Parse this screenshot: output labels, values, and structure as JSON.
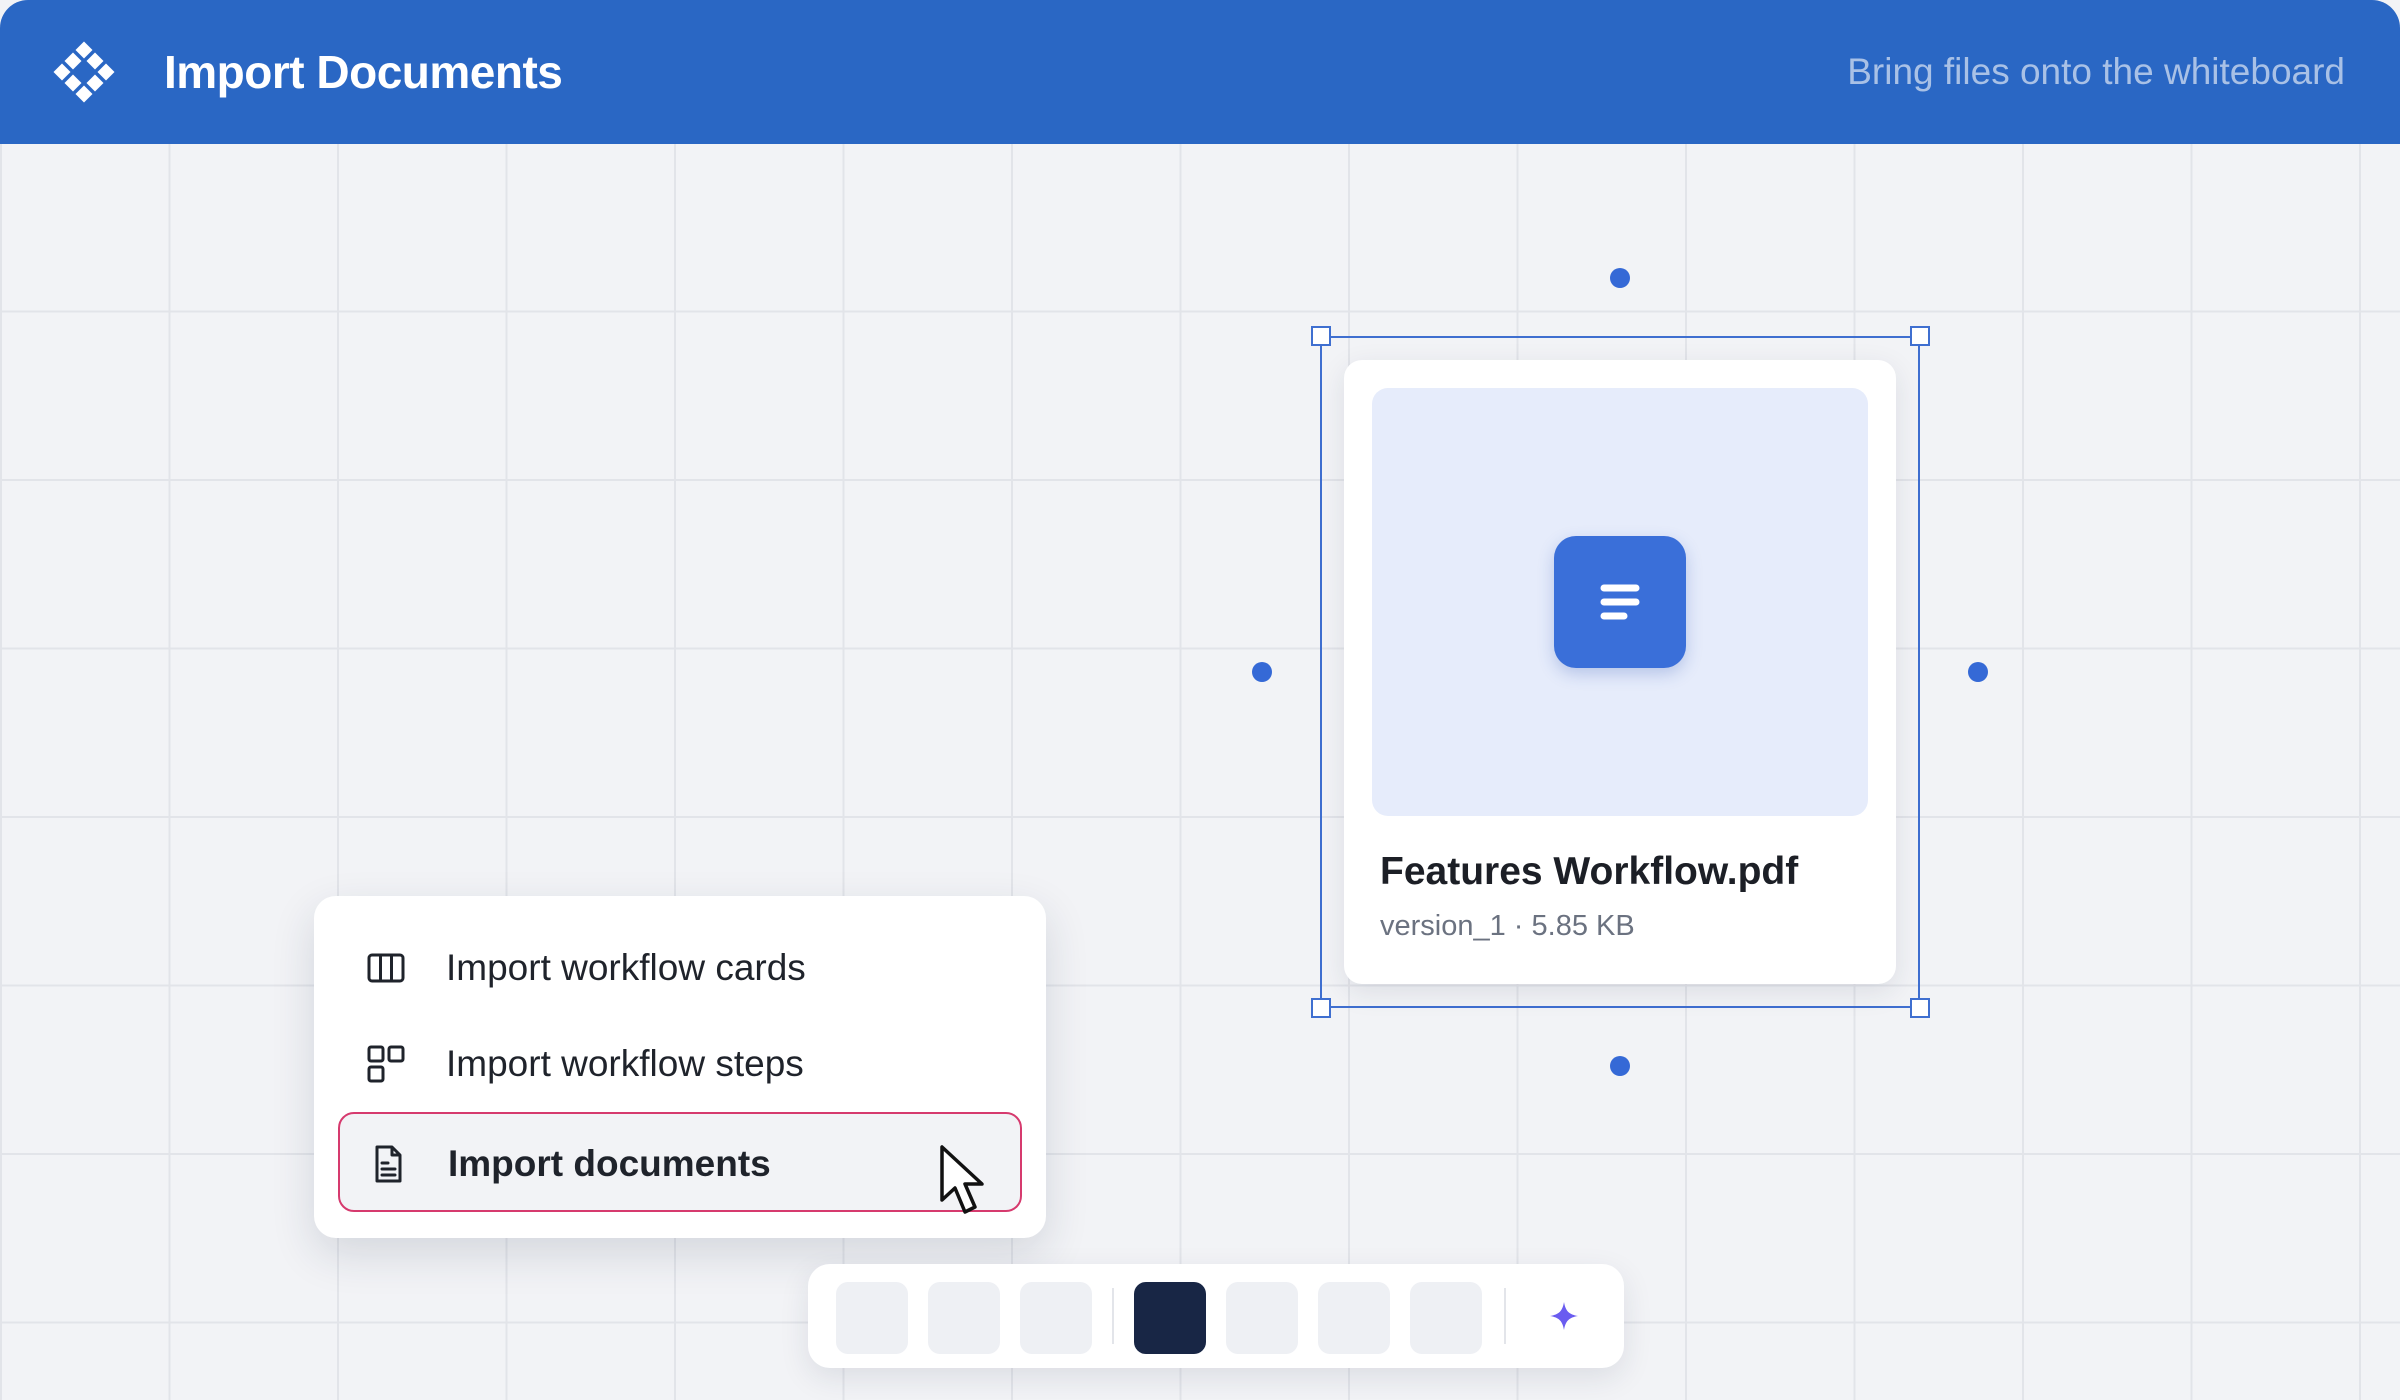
{
  "header": {
    "title": "Import Documents",
    "subtitle": "Bring files onto the whiteboard",
    "logo_icon": "diamond-grid-logo-icon",
    "background_color": "#2a67c4"
  },
  "document_card": {
    "file_name": "Features Workflow.pdf",
    "meta": "version_1 · 5.85 KB",
    "file_icon": "document-lines-icon",
    "badge_color": "#3a6fd9",
    "selected": true
  },
  "context_menu": {
    "items": [
      {
        "label": "Import workflow cards",
        "icon": "columns-icon",
        "active": false
      },
      {
        "label": "Import workflow steps",
        "icon": "grid-blocks-icon",
        "active": false
      },
      {
        "label": "Import documents",
        "icon": "document-icon",
        "active": true
      }
    ],
    "active_border_color": "#d63a6e"
  },
  "toolbar": {
    "tools": [
      {
        "name": "tool-1",
        "selected": false
      },
      {
        "name": "tool-2",
        "selected": false
      },
      {
        "name": "tool-3",
        "selected": false
      },
      {
        "name": "tool-4",
        "selected": true
      },
      {
        "name": "tool-5",
        "selected": false
      },
      {
        "name": "tool-6",
        "selected": false
      },
      {
        "name": "tool-7",
        "selected": false
      }
    ],
    "ai_icon": "sparkle-icon",
    "accent_color": "#6a5cf0"
  },
  "cursor_icon": "pointer-cursor-icon"
}
